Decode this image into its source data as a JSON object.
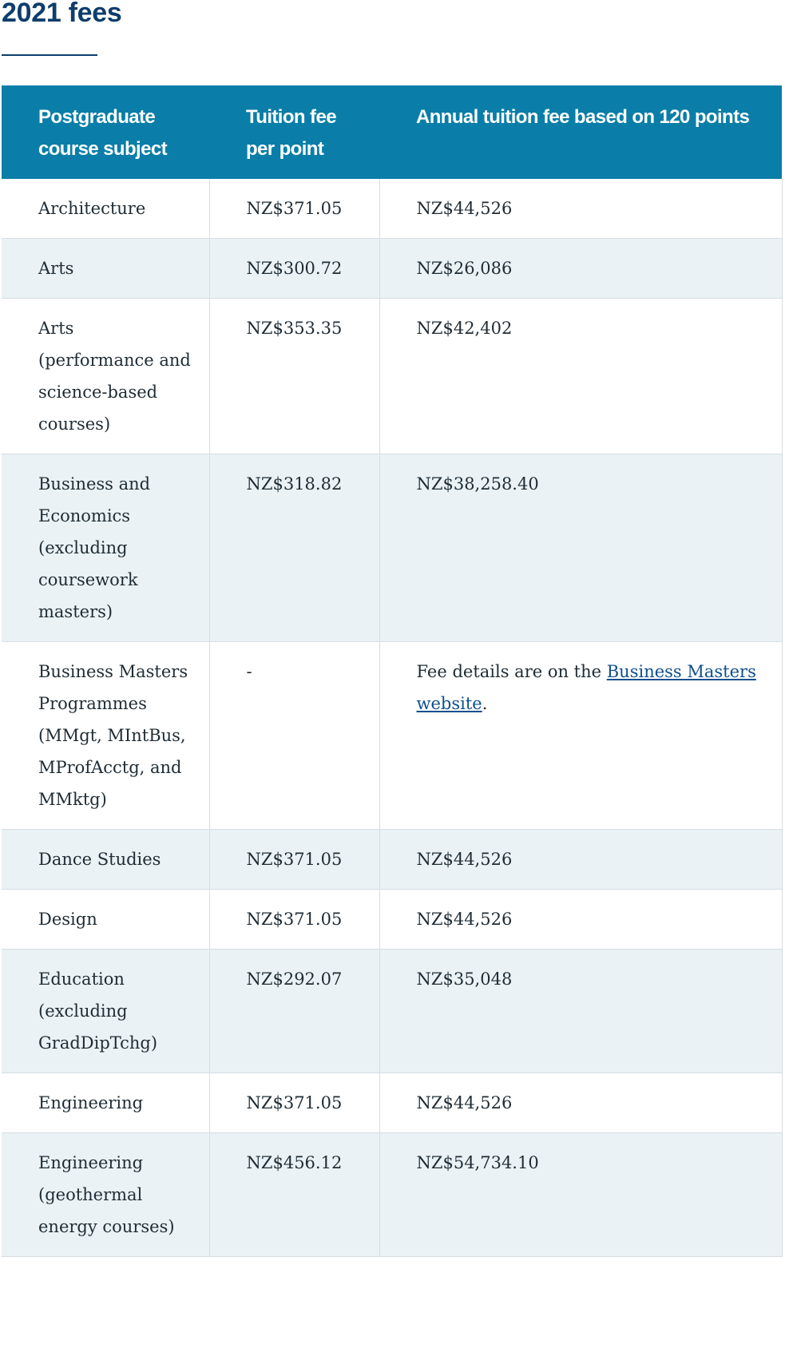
{
  "page": {
    "title": "2021 fees"
  },
  "table": {
    "headers": {
      "subject": "Postgraduate course subject",
      "per_point": "Tuition fee per point",
      "annual": "Annual tuition fee based on 120 points"
    },
    "rows": [
      {
        "subject": "Architecture",
        "per_point": "NZ$371.05",
        "annual": "NZ$44,526"
      },
      {
        "subject": "Arts",
        "per_point": "NZ$300.72",
        "annual": "NZ$26,086"
      },
      {
        "subject": "Arts (performance and science-based courses)",
        "per_point": "NZ$353.35",
        "annual": "NZ$42,402"
      },
      {
        "subject": "Business and Economics (excluding coursework masters)",
        "per_point": "NZ$318.82",
        "annual": "NZ$38,258.40"
      },
      {
        "subject": "Business Masters Programmes (MMgt, MIntBus, MProfAcctg, and MMktg)",
        "per_point": "-",
        "annual_prefix": "Fee details are on the ",
        "annual_link": "Business Masters website",
        "annual_suffix": "."
      },
      {
        "subject": "Dance Studies",
        "per_point": "NZ$371.05",
        "annual": "NZ$44,526"
      },
      {
        "subject": "Design",
        "per_point": "NZ$371.05",
        "annual": "NZ$44,526"
      },
      {
        "subject": "Education (excluding GradDipTchg)",
        "per_point": "NZ$292.07",
        "annual": "NZ$35,048"
      },
      {
        "subject": "Engineering",
        "per_point": "NZ$371.05",
        "annual": "NZ$44,526"
      },
      {
        "subject": "Engineering (geothermal energy courses)",
        "per_point": "NZ$456.12",
        "annual": "NZ$54,734.10"
      }
    ]
  },
  "colors": {
    "title": "#0e3d6b",
    "header_bg": "#0a7ea8",
    "row_alt_bg": "#eaf2f5",
    "link": "#0e4f8f"
  }
}
